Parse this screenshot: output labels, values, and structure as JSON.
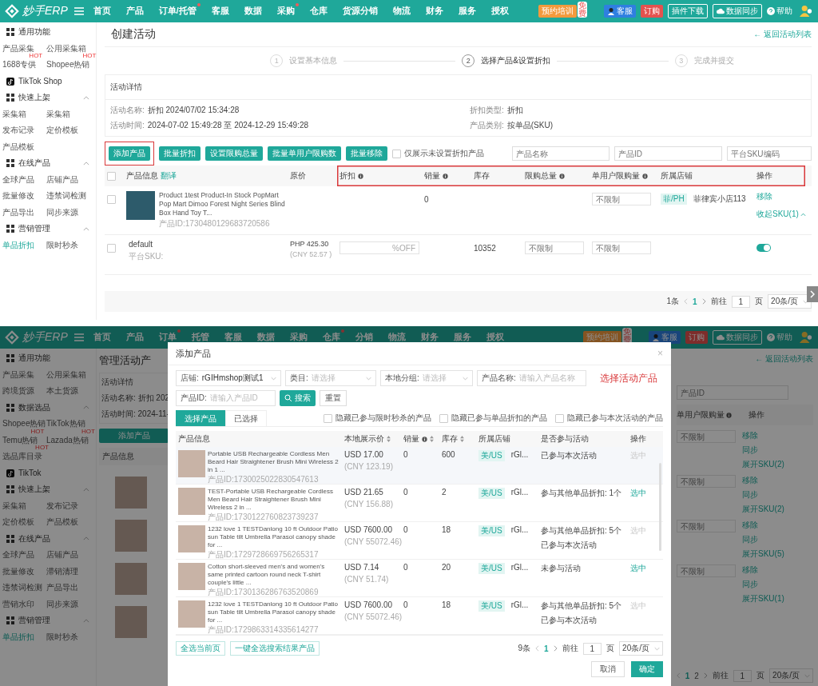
{
  "top_screen": {
    "nav": {
      "logo": "妙手ERP",
      "items": [
        {
          "label": "首页",
          "dot": false
        },
        {
          "label": "产品",
          "dot": false
        },
        {
          "label": "订单/托管",
          "dot": true
        },
        {
          "label": "客服",
          "dot": false
        },
        {
          "label": "数据",
          "dot": false
        },
        {
          "label": "采购",
          "dot": true
        },
        {
          "label": "仓库",
          "dot": false
        },
        {
          "label": "货源分销",
          "dot": false
        },
        {
          "label": "物流",
          "dot": false
        },
        {
          "label": "财务",
          "dot": false
        },
        {
          "label": "服务",
          "dot": false
        },
        {
          "label": "授权",
          "dot": false
        }
      ],
      "right": [
        {
          "kind": "promo",
          "label": "预约培训",
          "badge": "免费"
        },
        {
          "kind": "service",
          "label": "客服"
        },
        {
          "kind": "order",
          "label": "订购"
        },
        {
          "kind": "outline",
          "label": "插件下载"
        },
        {
          "kind": "sync",
          "label": "数据同步"
        },
        {
          "kind": "help",
          "label": "帮助"
        },
        {
          "kind": "user"
        }
      ]
    },
    "sidebar": [
      {
        "kind": "section",
        "label": "通用功能"
      },
      {
        "kind": "pair",
        "links": [
          {
            "label": "产品采集",
            "selected": false
          },
          {
            "label": "公用采集箱",
            "selected": false
          }
        ]
      },
      {
        "kind": "pair",
        "links": [
          {
            "label": "1688专供",
            "badge": "HOT",
            "selected": false
          },
          {
            "label": "Shopee热销",
            "badge": "HOT",
            "selected": false
          }
        ]
      },
      {
        "kind": "platform",
        "label": "TikTok Shop"
      },
      {
        "kind": "section",
        "label": "快速上架",
        "expanded": true
      },
      {
        "kind": "pair",
        "links": [
          {
            "label": "采集箱",
            "selected": false
          },
          {
            "label": "采集箱",
            "selected": false
          }
        ]
      },
      {
        "kind": "pair",
        "links": [
          {
            "label": "发布记录",
            "selected": false
          },
          {
            "label": "定价模板",
            "selected": false
          }
        ]
      },
      {
        "kind": "pair",
        "links": [
          {
            "label": "产品模板",
            "selected": false
          }
        ]
      },
      {
        "kind": "section",
        "label": "在线产品",
        "expanded": true
      },
      {
        "kind": "pair",
        "links": [
          {
            "label": "全球产品",
            "selected": false
          },
          {
            "label": "店铺产品",
            "selected": false
          }
        ]
      },
      {
        "kind": "pair",
        "links": [
          {
            "label": "批量修改",
            "selected": false
          },
          {
            "label": "违禁词检测",
            "selected": false
          }
        ]
      },
      {
        "kind": "pair",
        "links": [
          {
            "label": "产品导出",
            "selected": false
          },
          {
            "label": "同步来源",
            "selected": false
          }
        ]
      },
      {
        "kind": "section",
        "label": "营销管理",
        "expanded": true
      },
      {
        "kind": "pair",
        "links": [
          {
            "label": "单品折扣",
            "selected": true
          },
          {
            "label": "限时秒杀",
            "selected": false
          }
        ]
      }
    ],
    "page": {
      "title": "创建活动",
      "back_link": "← 返回活动列表",
      "steps": [
        {
          "number": "1",
          "label": "设置基本信息",
          "active": false
        },
        {
          "number": "2",
          "label": "选择产品&设置折扣",
          "active": true
        },
        {
          "number": "3",
          "label": "完成并提交",
          "active": false
        }
      ],
      "details": {
        "heading": "活动详情",
        "fields": [
          {
            "label": "活动名称:",
            "value": "折扣 2024/07/02 15:34:28"
          },
          {
            "label": "活动时间:",
            "value": "2024-07-02 15:49:28 至 2024-12-29 15:49:28"
          },
          {
            "label": "折扣类型:",
            "value": "折扣"
          },
          {
            "label": "产品类别:",
            "value": "按单品(SKU)"
          }
        ]
      },
      "toolbar": {
        "buttons": [
          {
            "label": "添加产品",
            "annotated": true
          },
          {
            "label": "批量折扣",
            "annotated": false
          },
          {
            "label": "设置限购总量",
            "annotated": false
          },
          {
            "label": "批量单用户限购数",
            "annotated": false
          },
          {
            "label": "批量移除",
            "annotated": false
          }
        ],
        "filter_checkbox": {
          "label": "仅展示未设置折扣产品",
          "checked": false
        },
        "search_fields": [
          {
            "placeholder": "产品名称"
          },
          {
            "placeholder": "产品ID"
          },
          {
            "placeholder": "平台SKU编码"
          }
        ]
      },
      "table": {
        "header_groups": [
          {
            "annotated": false,
            "columns": [
              {
                "kind": "checkbox",
                "checked": false
              },
              {
                "kind": "text",
                "label": "产品信息",
                "link": "翻译",
                "info": false
              },
              {
                "kind": "text",
                "label": "原价",
                "info": false
              }
            ]
          },
          {
            "annotated": true,
            "columns": [
              {
                "kind": "text",
                "label": "折扣",
                "info": true
              },
              {
                "kind": "text",
                "label": "销量",
                "info": true
              },
              {
                "kind": "text",
                "label": "库存",
                "info": false
              },
              {
                "kind": "text",
                "label": "限购总量",
                "info": true
              },
              {
                "kind": "text",
                "label": "单用户限购量",
                "info": true
              },
              {
                "kind": "text",
                "label": "所属店铺",
                "info": false
              },
              {
                "kind": "text",
                "label": "操作",
                "info": false
              }
            ]
          }
        ],
        "rows": [
          {
            "kind": "product",
            "checked": false,
            "title": "Product 1test Product-In Stock PopMart Pop Mart Dimoo Forest Night Series Blind Box Hand Toy T...",
            "product_id": "产品ID:1730480129683720586",
            "sales": "0",
            "per_user_limit": {
              "placeholder": "不限制"
            },
            "store": {
              "tag": "菲/PH",
              "name": "菲律宾小店113"
            },
            "actions": [
              {
                "label": "移除"
              },
              {
                "label": "收起SKU(1)",
                "expanded": true
              }
            ]
          },
          {
            "kind": "sku",
            "checked": false,
            "name": "default",
            "sku_label": "平台SKU:",
            "price": "PHP 425.30",
            "price_cny": "(CNY 52.57 )",
            "discount": {
              "suffix": "%OFF"
            },
            "stock": "10352",
            "total_limit": {
              "placeholder": "不限制"
            },
            "per_user_limit": {
              "placeholder": "不限制"
            },
            "enabled": true
          }
        ]
      },
      "pagination": {
        "total": "1条",
        "pages": [
          {
            "label": "1",
            "selected": true
          }
        ],
        "goto_label": "前往",
        "goto_value": "1",
        "page_unit": "页",
        "page_size": "20条/页"
      }
    }
  },
  "bottom_screen": {
    "nav": {
      "logo": "妙手ERP",
      "items": [
        {
          "label": "首页",
          "dot": false
        },
        {
          "label": "产品",
          "dot": false
        },
        {
          "label": "订单",
          "dot": true
        },
        {
          "label": "托管",
          "dot": false
        },
        {
          "label": "客服",
          "dot": false
        },
        {
          "label": "数据",
          "dot": false
        },
        {
          "label": "采购",
          "dot": false
        },
        {
          "label": "仓库",
          "dot": true
        },
        {
          "label": "分销",
          "dot": false
        },
        {
          "label": "物流",
          "dot": false
        },
        {
          "label": "财务",
          "dot": false
        },
        {
          "label": "服务",
          "dot": false
        },
        {
          "label": "授权",
          "dot": false
        }
      ],
      "right": [
        {
          "kind": "promo",
          "label": "预约培训",
          "badge": "免费"
        },
        {
          "kind": "service",
          "label": "客服"
        },
        {
          "kind": "order",
          "label": "订购"
        },
        {
          "kind": "sync",
          "label": "数据同步"
        },
        {
          "kind": "help",
          "label": "帮助"
        },
        {
          "kind": "user"
        }
      ]
    },
    "sidebar": [
      {
        "kind": "section",
        "label": "通用功能"
      },
      {
        "kind": "pair",
        "links": [
          {
            "label": "产品采集",
            "selected": false
          },
          {
            "label": "公用采集箱",
            "selected": false
          }
        ]
      },
      {
        "kind": "pair",
        "links": [
          {
            "label": "跨境货源",
            "selected": false
          },
          {
            "label": "本土货源",
            "selected": false
          }
        ]
      },
      {
        "kind": "section",
        "label": "数据选品",
        "expanded": true
      },
      {
        "kind": "pair",
        "links": [
          {
            "label": "Shopee热销",
            "selected": false
          },
          {
            "label": "TikTok热销",
            "selected": false
          }
        ]
      },
      {
        "kind": "pair",
        "links": [
          {
            "label": "Temu热销",
            "badge": "HOT",
            "selected": false
          },
          {
            "label": "Lazada热销",
            "badge": "HOT",
            "selected": false
          }
        ]
      },
      {
        "kind": "pair",
        "links": [
          {
            "label": "选品库目录",
            "badge": "HOT",
            "selected": false
          }
        ]
      },
      {
        "kind": "platform",
        "label": "TikTok"
      },
      {
        "kind": "section",
        "label": "快速上架",
        "expanded": true
      },
      {
        "kind": "pair",
        "links": [
          {
            "label": "采集箱",
            "selected": false
          },
          {
            "label": "发布记录",
            "selected": false
          }
        ]
      },
      {
        "kind": "pair",
        "links": [
          {
            "label": "定价模板",
            "selected": false
          },
          {
            "label": "产品模板",
            "selected": false
          }
        ]
      },
      {
        "kind": "section",
        "label": "在线产品",
        "expanded": true
      },
      {
        "kind": "pair",
        "links": [
          {
            "label": "全球产品",
            "selected": false
          },
          {
            "label": "店铺产品",
            "selected": false
          }
        ]
      },
      {
        "kind": "pair",
        "links": [
          {
            "label": "批量修改",
            "selected": false
          },
          {
            "label": "滞销清理",
            "selected": false
          }
        ]
      },
      {
        "kind": "pair",
        "links": [
          {
            "label": "违禁词检测",
            "selected": false
          },
          {
            "label": "产品导出",
            "selected": false
          }
        ]
      },
      {
        "kind": "pair",
        "links": [
          {
            "label": "营销水印",
            "selected": false
          },
          {
            "label": "同步来源",
            "selected": false
          }
        ]
      },
      {
        "kind": "section",
        "label": "营销管理",
        "expanded": true
      },
      {
        "kind": "pair",
        "links": [
          {
            "label": "单品折扣",
            "selected": true
          },
          {
            "label": "限时秒杀",
            "selected": false
          }
        ]
      }
    ],
    "background_left": {
      "title": "管理活动产",
      "heading": "活动详情",
      "fields": [
        "活动名称: 折扣 202",
        "活动时间: 2024-11-"
      ],
      "button": "添加产品",
      "column": "产品信息"
    },
    "background_right": {
      "back_link": "← 返回活动列表",
      "search_placeholder": "产品ID",
      "columns": [
        {
          "label": "单用户限购量",
          "info": true
        },
        {
          "label": "操作",
          "info": false
        }
      ],
      "rows": [
        {
          "placeholder": "不限制",
          "actions": [
            "移除",
            "同步",
            "展开SKU(2)"
          ]
        },
        {
          "placeholder": "不限制",
          "actions": [
            "移除",
            "同步",
            "展开SKU(2)"
          ]
        },
        {
          "placeholder": "不限制",
          "actions": [
            "移除",
            "同步",
            "展开SKU(5)"
          ]
        },
        {
          "placeholder": "不限制",
          "actions": [
            "移除",
            "同步",
            "展开SKU(1)"
          ]
        }
      ],
      "pagination": {
        "pages": [
          {
            "label": "1",
            "selected": true
          },
          {
            "label": "2",
            "selected": false
          }
        ],
        "goto_label": "前往",
        "goto_value": "1",
        "page_unit": "页",
        "page_size": "20条/页"
      }
    },
    "modal": {
      "title": "添加产品",
      "close": "×",
      "filter_rows": [
        [
          {
            "kind": "select",
            "label": "店铺:",
            "value": "rGIHmshop测试1"
          },
          {
            "kind": "select",
            "label": "类目:",
            "placeholder": "请选择"
          },
          {
            "kind": "select",
            "label": "本地分组:",
            "placeholder": "请选择"
          },
          {
            "kind": "input",
            "label": "产品名称:",
            "placeholder": "请输入产品名称"
          }
        ],
        [
          {
            "kind": "input",
            "label": "产品ID:",
            "placeholder": "请输入产品ID"
          }
        ]
      ],
      "search_button": "搜索",
      "reset_button": "重置",
      "annotation": "选择活动产品",
      "tabs": [
        {
          "label": "选择产品",
          "selected": true
        },
        {
          "label": "已选择",
          "selected": false
        }
      ],
      "hide_options": [
        {
          "label": "隐藏已参与限时秒杀的产品",
          "checked": false
        },
        {
          "label": "隐藏已参与单品折扣的产品",
          "checked": false
        },
        {
          "label": "隐藏已参与本次活动的产品",
          "checked": false
        }
      ],
      "columns": [
        {
          "label": "产品信息",
          "info": false,
          "sortable": false
        },
        {
          "label": "本地展示价",
          "info": false,
          "sortable": true
        },
        {
          "label": "销量",
          "info": true,
          "sortable": true
        },
        {
          "label": "库存",
          "info": false,
          "sortable": true
        },
        {
          "label": "所属店铺",
          "info": false,
          "sortable": false
        },
        {
          "label": "是否参与活动",
          "info": false,
          "sortable": false
        },
        {
          "label": "操作",
          "info": false,
          "sortable": false
        }
      ],
      "rows": [
        {
          "title": "Portable USB Rechargeable Cordless Men Beard Hair Straightener Brush Mini Wireless 2 in 1 ...",
          "product_id": "产品ID:1730025022830547613",
          "price": "USD 17.00",
          "price_cny": "(CNY 123.19)",
          "sales": "0",
          "stock": "600",
          "store_tag": "美/US",
          "store": "rGl...",
          "status": [
            "已参与本次活动"
          ],
          "action": "选中",
          "disabled": true
        },
        {
          "title": "TEST-Portable USB Rechargeable Cordless Men Beard Hair Straightener Brush Mini Wireless 2 in ...",
          "product_id": "产品ID:1730122760823739237",
          "price": "USD 21.65",
          "price_cny": "(CNY 156.88)",
          "sales": "0",
          "stock": "2",
          "store_tag": "美/US",
          "store": "rGl...",
          "status": [
            "参与其他单品折扣: 1个"
          ],
          "action": "选中",
          "disabled": false
        },
        {
          "title": "1232 love 1 TESTDanlong 10 ft Outdoor Patio sun Table tilt Umbrella Parasol canopy shade for ...",
          "product_id": "产品ID:1729728669756265317",
          "price": "USD 7600.00",
          "price_cny": "(CNY 55072.46)",
          "sales": "0",
          "stock": "18",
          "store_tag": "美/US",
          "store": "rGl...",
          "status": [
            "参与其他单品折扣: 5个",
            "已参与本次活动"
          ],
          "action": "选中",
          "disabled": true
        },
        {
          "title": "Cotton short-sleeved men's and women's same printed cartoon round neck T-shirt couple's little ...",
          "product_id": "产品ID:1730136286763520869",
          "price": "USD 7.14",
          "price_cny": "(CNY 51.74)",
          "sales": "0",
          "stock": "20",
          "store_tag": "美/US",
          "store": "rGl...",
          "status": [
            "未参与活动"
          ],
          "action": "选中",
          "disabled": false
        },
        {
          "title": "1232 love 1 TESTDanlong 10 ft Outdoor Patio sun Table tilt Umbrella Parasol canopy shade for ...",
          "product_id": "产品ID:1729863314335614277",
          "price": "USD 7600.00",
          "price_cny": "(CNY 55072.46)",
          "sales": "0",
          "stock": "18",
          "store_tag": "美/US",
          "store": "rGl...",
          "status": [
            "参与其他单品折扣: 5个",
            "已参与本次活动"
          ],
          "action": "选中",
          "disabled": true
        }
      ],
      "select_page": "全选当前页",
      "select_all": "一键全选搜索结果产品",
      "pagination": {
        "total": "9条",
        "pages": [
          {
            "label": "1",
            "selected": true
          }
        ],
        "goto_label": "前往",
        "goto_value": "1",
        "page_unit": "页",
        "page_size": "20条/页"
      },
      "cancel": "取消",
      "confirm": "确定"
    }
  }
}
